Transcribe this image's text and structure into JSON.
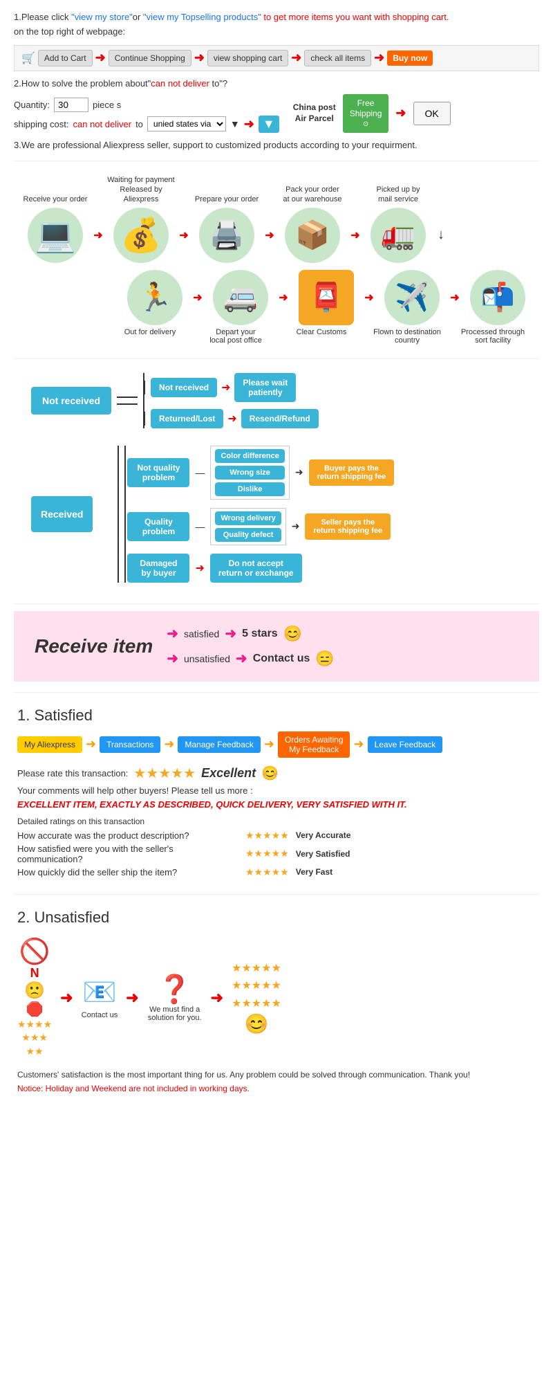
{
  "section1": {
    "text1": "1.Please click ",
    "link1": "\"view my store\"",
    "text2": "or ",
    "link2": "\"view my Topselling products\"",
    "text3": " to get more items you want with shopping cart.",
    "text4": "on the top right of webpage:",
    "steps": [
      {
        "label": "Add to Cart",
        "type": "cart"
      },
      {
        "label": "Continue Shopping",
        "type": "gray"
      },
      {
        "label": "view shopping cart",
        "type": "gray"
      },
      {
        "label": "check all items",
        "type": "gray"
      },
      {
        "label": "Buy now",
        "type": "orange"
      }
    ]
  },
  "section2": {
    "title": "2.How to solve the problem about\"can not deliver to\"?",
    "qty_label": "Quantity:",
    "qty_value": "30",
    "piece_label": "piece s",
    "shipping_label": "shipping cost:",
    "cannot_deliver": "can not deliver",
    "to_text": " to ",
    "via_text": "unied states via",
    "china_post_line1": "China post",
    "china_post_line2": "Air Parcel",
    "free_shipping_line1": "Free",
    "free_shipping_line2": "Shipping",
    "ok_label": "OK"
  },
  "section3": {
    "text": "3.We are professional Aliexpress seller, support to customized products according to your requirment."
  },
  "flow": {
    "steps_top": [
      {
        "label": "Receive your order",
        "icon": "💻"
      },
      {
        "label": "Waiting for payment Released by Aliexpress",
        "icon": "💰"
      },
      {
        "label": "Prepare your order",
        "icon": "🖨️"
      },
      {
        "label": "Pack your order at our warehouse",
        "icon": "📦"
      },
      {
        "label": "Picked up by mail service",
        "icon": "🚛"
      }
    ],
    "steps_bottom": [
      {
        "label": "Out for delivery",
        "icon": "🏃"
      },
      {
        "label": "Depart your local post office",
        "icon": "🚐"
      },
      {
        "label": "Clear Customs",
        "icon": "📮"
      },
      {
        "label": "Flown to destination country",
        "icon": "✈️"
      },
      {
        "label": "Processed through sort facility",
        "icon": "📬"
      }
    ]
  },
  "not_received": {
    "main": "Not received",
    "branches": [
      {
        "label": "Not received",
        "outcome": "Please wait patiently"
      },
      {
        "label": "Returned/Lost",
        "outcome": "Resend/Refund"
      }
    ]
  },
  "received": {
    "main": "Received",
    "branches": [
      {
        "label": "Not quality problem",
        "sub": [
          "Color difference",
          "Wrong size",
          "Dislike"
        ],
        "outcome": "Buyer pays the return shipping fee"
      },
      {
        "label": "Quality problem",
        "sub": [
          "Wrong delivery",
          "Quality defect"
        ],
        "outcome": "Seller pays the return shipping fee"
      },
      {
        "label": "Damaged by buyer",
        "outcome_direct": "Do not accept return or exchange"
      }
    ]
  },
  "receive_item": {
    "title": "Receive item",
    "outcomes": [
      {
        "condition": "satisfied",
        "result": "5 stars",
        "emoji": "😊"
      },
      {
        "condition": "unsatisfied",
        "result": "Contact us",
        "emoji": "😑"
      }
    ]
  },
  "satisfied": {
    "title": "1. Satisfied",
    "nav": [
      "My Aliexpress",
      "Transactions",
      "Manage Feedback",
      "Orders Awaiting My Feedback",
      "Leave Feedback"
    ],
    "rate_label": "Please rate this transaction:",
    "stars": "★★★★★",
    "excellent_label": "Excellent",
    "emoji": "😊",
    "comment_label": "Your comments will help other buyers! Please tell us more :",
    "review_text": "EXCELLENT ITEM, EXACTLY AS DESCRIBED, QUICK DELIVERY, VERY SATISFIED WITH IT.",
    "detailed_label": "Detailed ratings on this transaction",
    "ratings": [
      {
        "question": "How accurate was the product description?",
        "stars": "★★★★★",
        "text": "Very Accurate"
      },
      {
        "question": "How satisfied were you with the seller's communication?",
        "stars": "★★★★★",
        "text": "Very Satisfied"
      },
      {
        "question": "How quickly did the seller ship the item?",
        "stars": "★★★★★",
        "text": "Very Fast"
      }
    ]
  },
  "unsatisfied": {
    "title": "2. Unsatisfied",
    "steps": [
      {
        "icon": "🚫",
        "sub": "N\n🙁\n🛑"
      },
      {
        "icon": "📧"
      },
      {
        "icon": "❓",
        "sub": "We must find a solution for you."
      },
      {
        "icon": "⭐⭐⭐⭐⭐\n⭐⭐⭐⭐⭐\n⭐⭐⭐⭐⭐",
        "sub": "😊"
      }
    ],
    "contact_label": "Contact us",
    "find_solution": "We must find a solution for you.",
    "notice": "Customers' satisfaction is the most important thing for us. Any problem could be solved through communication. Thank you!",
    "holiday_notice": "Notice: Holiday and Weekend are not included in working days."
  }
}
